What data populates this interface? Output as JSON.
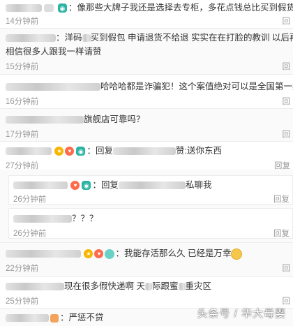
{
  "comments": [
    {
      "text": "：像那些大牌子我还是选择去专柜，多花点钱总比买到假货好",
      "time": "14分钟前",
      "reply": "回"
    },
    {
      "text_a": "：洋码",
      "text_b": "买到假包 申请退货不给退 实实在在打脸的教训 以后再也",
      "text_c": "相信很多人跟我一样请赞",
      "time": "15分钟前",
      "reply": "回"
    },
    {
      "text": "哈哈哈都是诈骗犯！这个案值绝对可以是全国第一案",
      "time": "16分钟前",
      "reply": "回"
    },
    {
      "text": "旗舰店可靠吗？",
      "time": "17分钟前",
      "reply": "回"
    },
    {
      "text_a": "：回复",
      "text_b": "赞:送你东西",
      "time": "27分钟前",
      "reply": "回复"
    },
    {
      "nested": true,
      "text_a": "：回复",
      "text_b": "私聊我",
      "time": "26分钟前",
      "reply": "回复"
    },
    {
      "nested": true,
      "text": "？？？",
      "time": "26分钟前",
      "reply": "回复"
    },
    {
      "text": "：我能存活那么久 已经是万幸",
      "time": "22分钟前",
      "reply": "回"
    },
    {
      "text_a": "现在很多假快递啊 天",
      "text_b": "际跟蜜",
      "text_c": "重灾区",
      "time": "25分钟前",
      "reply": "回"
    },
    {
      "text": "：严惩不贷",
      "time": "",
      "reply": ""
    }
  ],
  "watermark": "头条号 / 华大母婴"
}
